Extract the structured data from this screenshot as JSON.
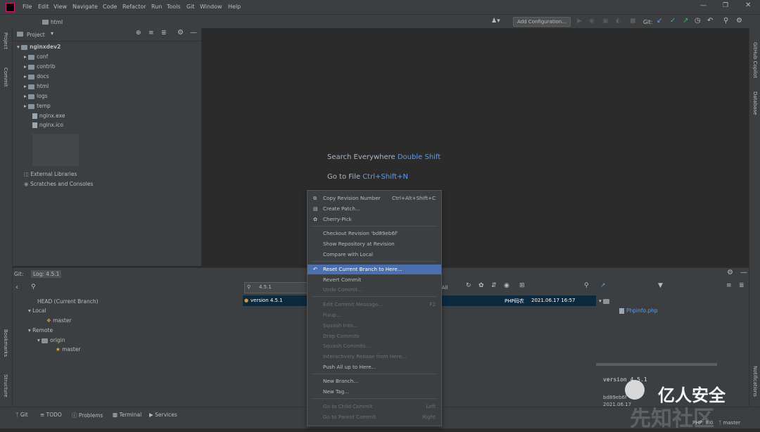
{
  "menubar": {
    "items": [
      "File",
      "Edit",
      "View",
      "Navigate",
      "Code",
      "Refactor",
      "Run",
      "Tools",
      "Git",
      "Window",
      "Help"
    ]
  },
  "navbar": {
    "breadcrumb": "html",
    "add_configuration": "Add Configuration...",
    "git_label": "Git:"
  },
  "left_stripe": {
    "project": "Project",
    "commit": "Commit",
    "bookmarks": "Bookmarks",
    "structure": "Structure"
  },
  "right_stripe": {
    "copilot": "GitHub Copilot",
    "database": "Database",
    "notifications": "Notifications"
  },
  "project_panel": {
    "title": "Project",
    "root": "nginxdev2",
    "items": [
      "conf",
      "contrib",
      "docs",
      "html",
      "logs",
      "temp"
    ],
    "files": [
      "nginx.exe",
      "nginx.ico"
    ],
    "external": "External Libraries",
    "scratches": "Scratches and Consoles"
  },
  "editor_hints": {
    "search_label": "Search Everywhere",
    "search_key": "Double Shift",
    "goto_label": "Go to File",
    "goto_key": "Ctrl+Shift+N"
  },
  "git_panel": {
    "tab_git": "Git:",
    "tab_log": "Log: 4.5.1",
    "branches": {
      "head": "HEAD (Current Branch)",
      "local": "Local",
      "local_master": "master",
      "remote": "Remote",
      "origin": "origin",
      "origin_master": "master"
    },
    "filter_value": "4.5.1",
    "filter_all": ": All",
    "commit": {
      "message": "version 4.5.1",
      "author": "PHP码农",
      "date": "2021.06.17 16:57"
    },
    "changed_file": "Phpinfo.php",
    "details_title": "version 4.5.1",
    "details_hash": "bd89eb6f",
    "details_date": "2021.06.17"
  },
  "context_menu": {
    "items": [
      {
        "label": "Copy Revision Number",
        "shortcut": "Ctrl+Alt+Shift+C",
        "enabled": true
      },
      {
        "label": "Create Patch...",
        "shortcut": "",
        "enabled": true
      },
      {
        "label": "Cherry-Pick",
        "shortcut": "",
        "enabled": true
      },
      {
        "label": "Checkout Revision 'bd89eb6f'",
        "shortcut": "",
        "enabled": true
      },
      {
        "label": "Show Repository at Revision",
        "shortcut": "",
        "enabled": true
      },
      {
        "label": "Compare with Local",
        "shortcut": "",
        "enabled": true
      },
      {
        "label": "Reset Current Branch to Here...",
        "shortcut": "",
        "enabled": true
      },
      {
        "label": "Revert Commit",
        "shortcut": "",
        "enabled": true
      },
      {
        "label": "Undo Commit...",
        "shortcut": "",
        "enabled": false
      },
      {
        "label": "Edit Commit Message...",
        "shortcut": "F2",
        "enabled": false
      },
      {
        "label": "Fixup...",
        "shortcut": "",
        "enabled": false
      },
      {
        "label": "Squash Into...",
        "shortcut": "",
        "enabled": false
      },
      {
        "label": "Drop Commits",
        "shortcut": "",
        "enabled": false
      },
      {
        "label": "Squash Commits...",
        "shortcut": "",
        "enabled": false
      },
      {
        "label": "Interactively Rebase from Here...",
        "shortcut": "",
        "enabled": false
      },
      {
        "label": "Push All up to Here...",
        "shortcut": "",
        "enabled": true
      },
      {
        "label": "New Branch...",
        "shortcut": "",
        "enabled": true
      },
      {
        "label": "New Tag...",
        "shortcut": "",
        "enabled": true
      },
      {
        "label": "Go to Child Commit",
        "shortcut": "Left",
        "enabled": false
      },
      {
        "label": "Go to Parent Commit",
        "shortcut": "Right",
        "enabled": false
      }
    ]
  },
  "toolwindows": {
    "git": "Git",
    "todo": "TODO",
    "problems": "Problems",
    "terminal": "Terminal",
    "services": "Services"
  },
  "status": {
    "php": "PHP: 8.0",
    "branch": "master"
  },
  "watermark": {
    "brand": "亿人安全",
    "site": "先知社区"
  },
  "colors": {
    "accent": "#589df6",
    "selection": "#4b6eaf",
    "panel": "#3c3f41",
    "editor": "#2b2b2b",
    "green": "#59a869",
    "folder": "#87939a"
  }
}
